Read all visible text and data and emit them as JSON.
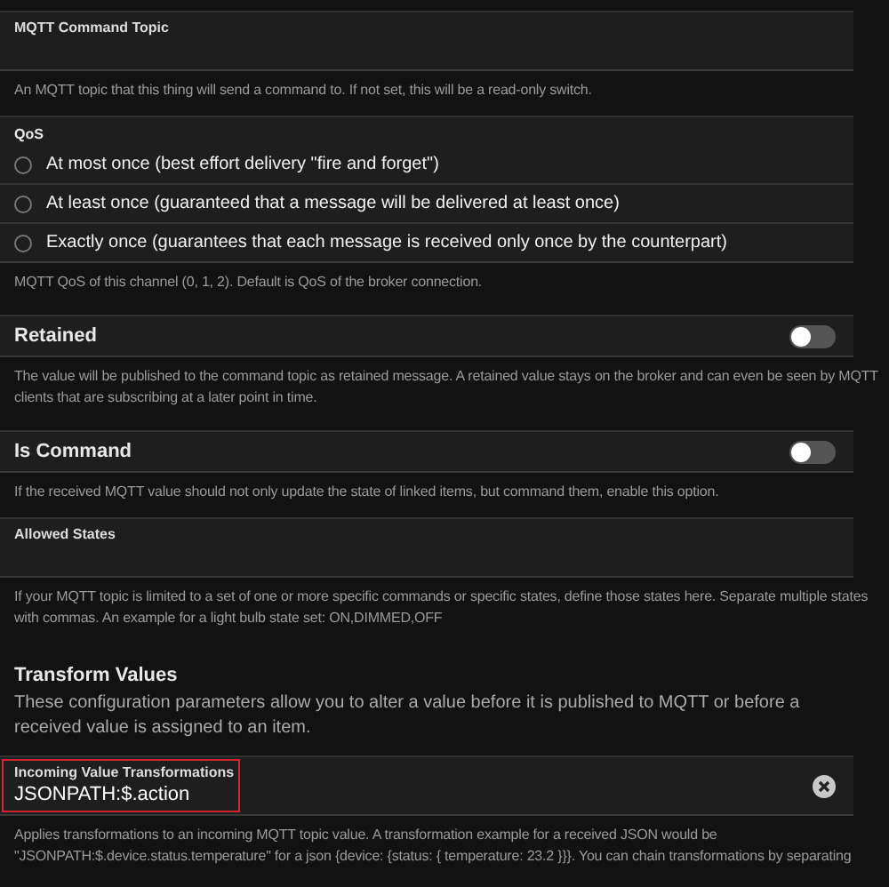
{
  "items": [
    {
      "kind": "field",
      "label": "MQTT Command Topic",
      "value": "",
      "highlighted": false,
      "clearable": false,
      "hint": "An MQTT topic that this thing will send a command to. If not set, this will be a read-only switch."
    },
    {
      "kind": "radios",
      "label": "QoS",
      "options": [
        {
          "label": "At most once (best effort delivery \"fire and forget\")",
          "selected": false
        },
        {
          "label": "At least once (guaranteed that a message will be delivered at least once)",
          "selected": false
        },
        {
          "label": "Exactly once (guarantees that each message is received only once by the counterpart)",
          "selected": false
        }
      ],
      "hint": "MQTT QoS of this channel (0, 1, 2). Default is QoS of the broker connection."
    },
    {
      "kind": "toggle",
      "label": "Retained",
      "on": false,
      "hint": "The value will be published to the command topic as retained message. A retained value stays on the broker and can even be seen by MQTT clients that are subscribing at a later point in time."
    },
    {
      "kind": "toggle",
      "label": "Is Command",
      "on": false,
      "hint": "If the received MQTT value should not only update the state of linked items, but command them, enable this option."
    },
    {
      "kind": "field",
      "label": "Allowed States",
      "value": "",
      "highlighted": false,
      "clearable": false,
      "hint": "If your MQTT topic is limited to a set of one or more specific commands or specific states, define those states here. Separate multiple states with commas. An example for a light bulb state set: ON,DIMMED,OFF"
    },
    {
      "kind": "heading",
      "label": "Transform Values",
      "hint": "These configuration parameters allow you to alter a value before it is published to MQTT or before a received value is assigned to an item."
    },
    {
      "kind": "field",
      "label": "Incoming Value Transformations",
      "value": "JSONPATH:$.action",
      "highlighted": true,
      "clearable": true,
      "hint": "Applies transformations to an incoming MQTT topic value. A transformation example for a received JSON would be \"JSONPATH:$.device.status.temperature\" for a json {device: {status: { temperature: 23.2 }}}. You can chain transformations by separating"
    }
  ]
}
